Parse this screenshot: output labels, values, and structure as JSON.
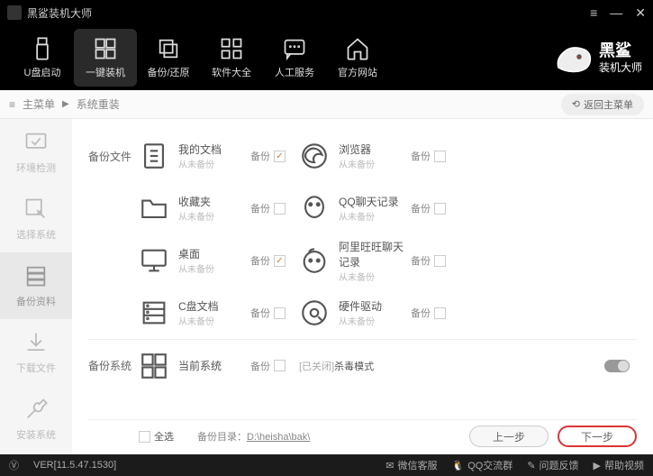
{
  "title": "黑鲨装机大师",
  "topnav": [
    {
      "label": "U盘启动"
    },
    {
      "label": "一键装机"
    },
    {
      "label": "备份/还原"
    },
    {
      "label": "软件大全"
    },
    {
      "label": "人工服务"
    },
    {
      "label": "官方网站"
    }
  ],
  "brand": {
    "big": "黑鲨",
    "small": "装机大师"
  },
  "breadcrumb": {
    "icon": "≡",
    "main": "主菜单",
    "sep": "▶",
    "current": "系统重装",
    "back": "返回主菜单"
  },
  "sidebar": [
    {
      "label": "环境检测"
    },
    {
      "label": "选择系统"
    },
    {
      "label": "备份资料"
    },
    {
      "label": "下载文件"
    },
    {
      "label": "安装系统"
    }
  ],
  "sections": {
    "files": "备份文件",
    "system": "备份系统"
  },
  "backup_label": "备份",
  "never_backup": "从未备份",
  "items_left": [
    {
      "title": "我的文档",
      "checked": true
    },
    {
      "title": "收藏夹",
      "checked": false
    },
    {
      "title": "桌面",
      "checked": true
    },
    {
      "title": "C盘文档",
      "checked": false
    }
  ],
  "items_right": [
    {
      "title": "浏览器"
    },
    {
      "title": "QQ聊天记录"
    },
    {
      "title": "阿里旺旺聊天记录"
    },
    {
      "title": "硬件驱动"
    }
  ],
  "system_item": {
    "title": "当前系统"
  },
  "kill_mode": {
    "prefix": "[已关闭]",
    "label": " 杀毒模式"
  },
  "select_all": "全选",
  "dir": {
    "label": "备份目录：",
    "path": "D:\\heisha\\bak\\"
  },
  "buttons": {
    "prev": "上一步",
    "next": "下一步"
  },
  "status": {
    "ver": "VER[11.5.47.1530]",
    "wechat": "微信客服",
    "qq": "QQ交流群",
    "feedback": "问题反馈",
    "help": "帮助视频"
  }
}
